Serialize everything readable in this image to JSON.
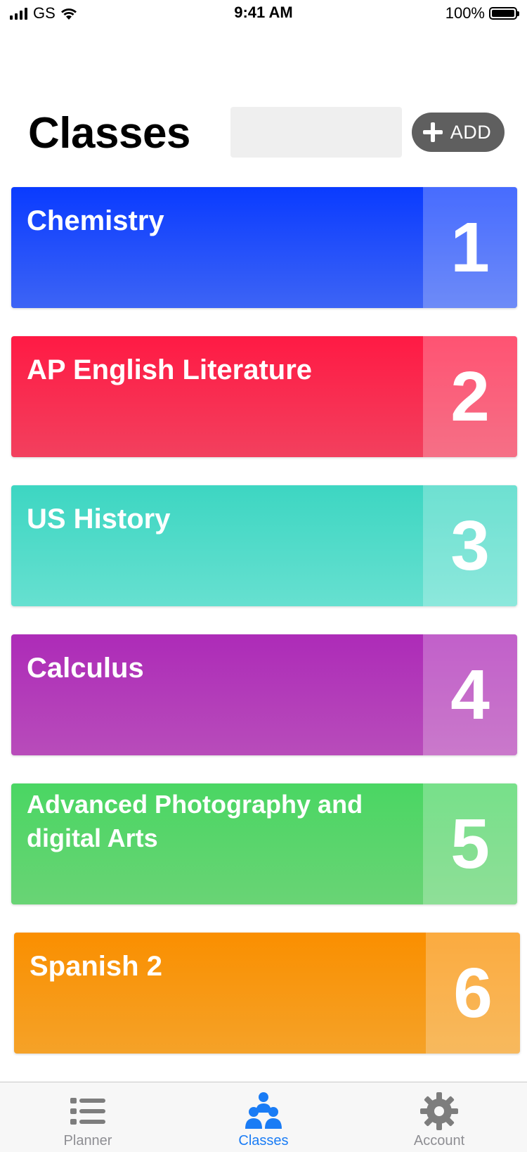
{
  "status_bar": {
    "carrier": "GS",
    "time": "9:41 AM",
    "battery": "100%"
  },
  "header": {
    "title": "Classes",
    "search_placeholder": "",
    "add_label": "ADD"
  },
  "colors": {
    "add_button": "#5f5f5f",
    "tab_active": "#1a7cf5",
    "tab_inactive": "#8e8e93"
  },
  "classes": [
    {
      "name": "Chemistry",
      "number": "1",
      "color_top": "#0a3bff",
      "color_bottom": "#3d64f5"
    },
    {
      "name": "AP English Literature",
      "number": "2",
      "color_top": "#ff1a44",
      "color_bottom": "#f2405e"
    },
    {
      "name": "US History",
      "number": "3",
      "color_top": "#3dd6c2",
      "color_bottom": "#66e0d0"
    },
    {
      "name": "Calculus",
      "number": "4",
      "color_top": "#ad2bb8",
      "color_bottom": "#b84cba"
    },
    {
      "name": "Advanced Photography and digital Arts",
      "number": "5",
      "color_top": "#4ad663",
      "color_bottom": "#69d475"
    },
    {
      "name": "Spanish 2",
      "number": "6",
      "color_top": "#fa8f00",
      "color_bottom": "#f5a228"
    }
  ],
  "tabs": [
    {
      "label": "Planner",
      "icon": "list-icon",
      "active": false
    },
    {
      "label": "Classes",
      "icon": "people-icon",
      "active": true
    },
    {
      "label": "Account",
      "icon": "gear-icon",
      "active": false
    }
  ]
}
